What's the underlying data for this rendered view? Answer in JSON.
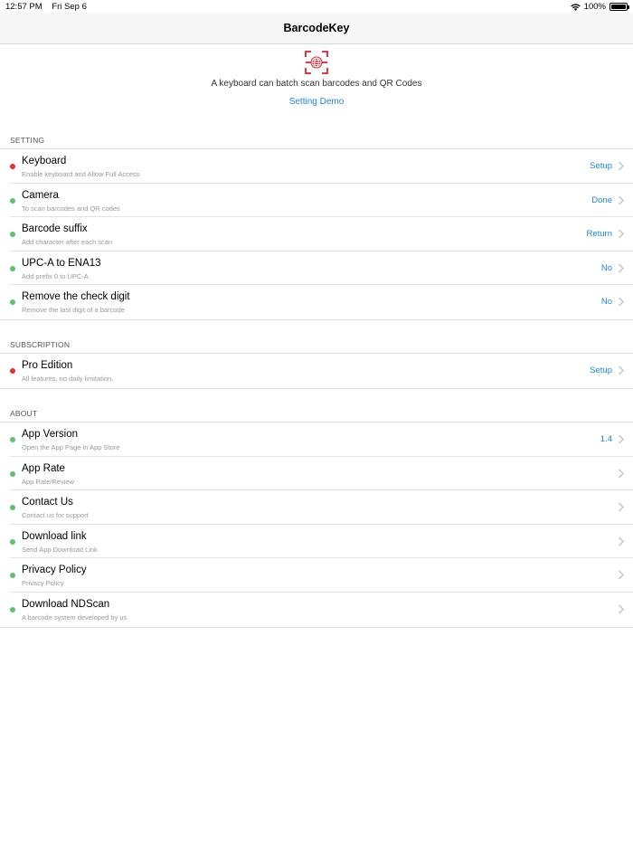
{
  "status_bar": {
    "time": "12:57 PM",
    "date": "Fri Sep 6",
    "battery": "100%",
    "wifi_icon": "wifi-icon",
    "battery_icon": "battery-icon"
  },
  "nav": {
    "title": "BarcodeKey"
  },
  "hero": {
    "logo_icon": "barcode-scan-globe-icon",
    "description": "A keyboard can batch scan barcodes and QR Codes",
    "demo_link": "Setting Demo"
  },
  "colors": {
    "accent": "#1a86e6",
    "status_ok": "#5ac36e",
    "status_error": "#ee2c2c",
    "logo_red": "#d9232e"
  },
  "sections": [
    {
      "header": "SETTING",
      "rows": [
        {
          "title": "Keyboard",
          "subtitle": "Enable keyboard and Allow Full Access",
          "value": "Setup",
          "status": "red"
        },
        {
          "title": "Camera",
          "subtitle": "To scan barcodes and QR codes",
          "value": "Done",
          "status": "green"
        },
        {
          "title": "Barcode suffix",
          "subtitle": "Add character after each scan",
          "value": "Return",
          "status": "green"
        },
        {
          "title": "UPC-A to ENA13",
          "subtitle": "Add prefix 0 to UPC-A",
          "value": "No",
          "status": "green"
        },
        {
          "title": "Remove the check digit",
          "subtitle": "Remove the last digit of a barcode",
          "value": "No",
          "status": "green"
        }
      ]
    },
    {
      "header": "SUBSCRIPTION",
      "rows": [
        {
          "title": "Pro Edition",
          "subtitle": "All features, no daily limitation.",
          "value": "Setup",
          "status": "red"
        }
      ]
    },
    {
      "header": "ABOUT",
      "rows": [
        {
          "title": "App Version",
          "subtitle": "Open the App Page in App Store",
          "value": "1.4",
          "status": "green"
        },
        {
          "title": "App Rate",
          "subtitle": "App Rate/Review",
          "value": "",
          "status": "green"
        },
        {
          "title": "Contact Us",
          "subtitle": "Contact us for support",
          "value": "",
          "status": "green"
        },
        {
          "title": "Download link",
          "subtitle": "Send App Download Link",
          "value": "",
          "status": "green"
        },
        {
          "title": "Privacy Policy",
          "subtitle": "Privacy Policy",
          "value": "",
          "status": "green"
        },
        {
          "title": "Download NDScan",
          "subtitle": "A barcode system developed by us",
          "value": "",
          "status": "green"
        }
      ]
    }
  ]
}
